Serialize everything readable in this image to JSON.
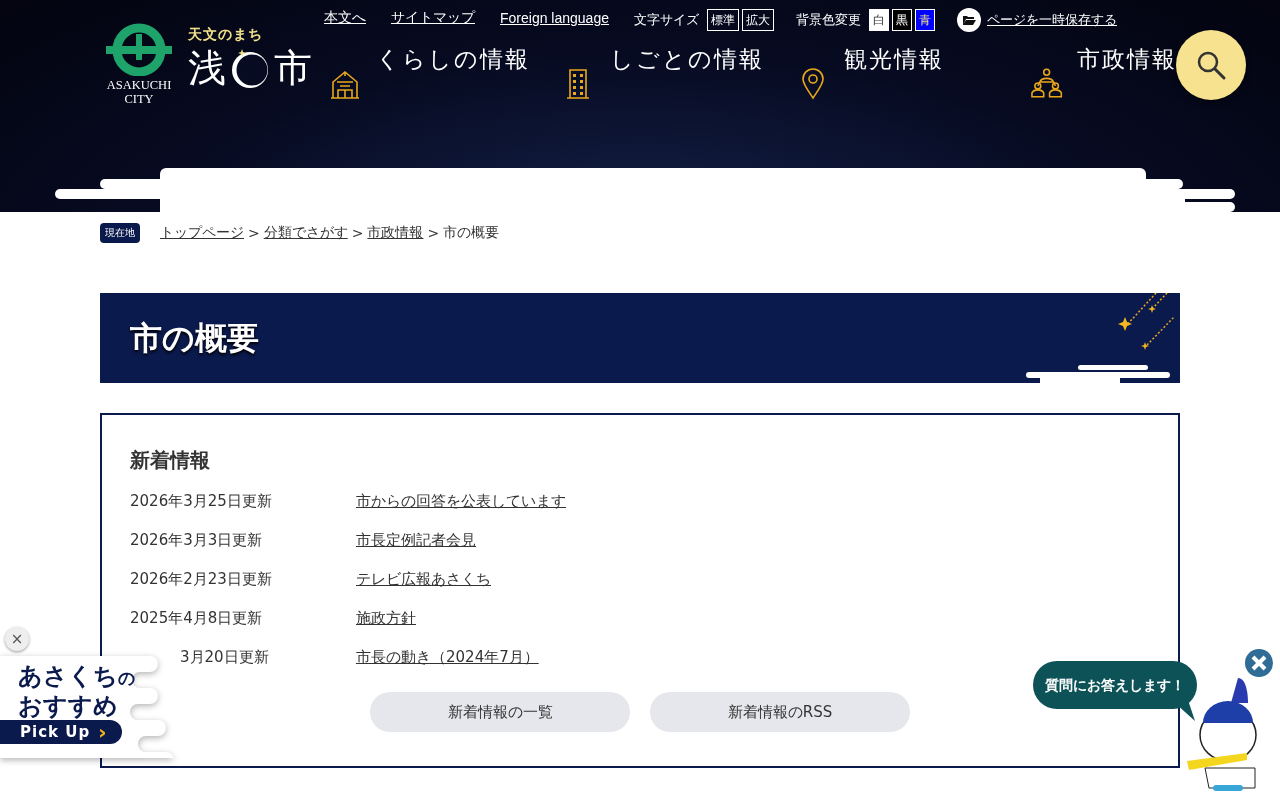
{
  "header": {
    "logo": {
      "tagline": "天文のまち",
      "name_left": "浅",
      "name_right": "市",
      "english": [
        "ASAKUCHI",
        "CITY"
      ]
    },
    "utility_links": [
      {
        "label": "本文へ"
      },
      {
        "label": "サイトマップ"
      },
      {
        "label": "Foreign language"
      }
    ],
    "font_size": {
      "label": "文字サイズ",
      "options": [
        {
          "label": "標準"
        },
        {
          "label": "拡大"
        }
      ]
    },
    "bg_color": {
      "label": "背景色変更",
      "options": [
        {
          "label": "白",
          "color": "#ffffff"
        },
        {
          "label": "黒",
          "color": "#000000"
        },
        {
          "label": "青",
          "color": "#0000ff"
        }
      ]
    },
    "save_page": {
      "label": "ページを一時保存する"
    },
    "nav": [
      {
        "label": "くらしの情報",
        "kind": "house"
      },
      {
        "label": "しごとの情報",
        "kind": "building"
      },
      {
        "label": "観光情報",
        "kind": "pin"
      },
      {
        "label": "市政情報",
        "kind": "people"
      }
    ]
  },
  "breadcrumb": {
    "badge": "現在地",
    "items": [
      {
        "label": "トップページ",
        "link": true
      },
      {
        "sep": ">",
        "label": "分類でさがす",
        "link": true
      },
      {
        "sep": ">",
        "label": "市政情報",
        "link": true
      },
      {
        "sep": ">",
        "label": "市の概要",
        "link": false
      }
    ]
  },
  "page_title": "市の概要",
  "news": {
    "heading": "新着情報",
    "items": [
      {
        "date": "2026年3月25日更新",
        "title": "市からの回答を公表しています",
        "covered": false
      },
      {
        "date": "2026年3月3日更新",
        "title": "市長定例記者会見",
        "covered": false
      },
      {
        "date": "2026年2月23日更新",
        "title": "テレビ広報あさくち",
        "covered": false
      },
      {
        "date": "2025年4月8日更新",
        "title": "施政方針",
        "covered": false
      },
      {
        "date": "3月20日更新",
        "title": "市長の動き（2024年7月）",
        "covered": true
      }
    ],
    "buttons": [
      {
        "label": "新着情報の一覧"
      },
      {
        "label": "新着情報のRSS"
      }
    ]
  },
  "pickup": {
    "close": "×",
    "line1": "あさくち",
    "line1_small": "の",
    "line2": "おすすめ",
    "button": "Pick Up",
    "arrow": "›"
  },
  "chat": {
    "bubble": "質問にお答えします！"
  }
}
